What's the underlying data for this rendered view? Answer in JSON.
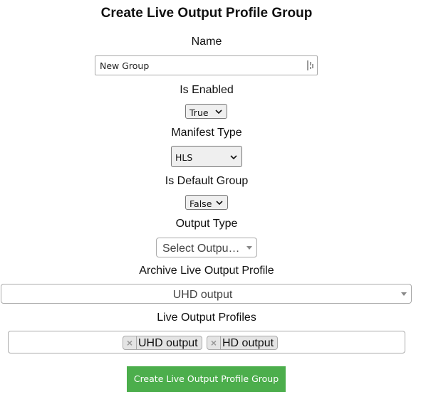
{
  "form": {
    "title": "Create Live Output Profile Group",
    "name": {
      "label": "Name",
      "value": "New Group"
    },
    "is_enabled": {
      "label": "Is Enabled",
      "value": "True"
    },
    "manifest_type": {
      "label": "Manifest Type",
      "value": "HLS"
    },
    "is_default_group": {
      "label": "Is Default Group",
      "value": "False"
    },
    "output_type": {
      "label": "Output Type",
      "placeholder": "Select Outpu…"
    },
    "archive_profile": {
      "label": "Archive Live Output Profile",
      "value": "UHD output"
    },
    "live_profiles": {
      "label": "Live Output Profiles",
      "tags": [
        "UHD output",
        "HD output"
      ],
      "remove_symbol": "×"
    },
    "submit_label": "Create Live Output Profile Group"
  },
  "colors": {
    "submit_bg": "#4cae4c",
    "select_bg": "#efefef"
  }
}
